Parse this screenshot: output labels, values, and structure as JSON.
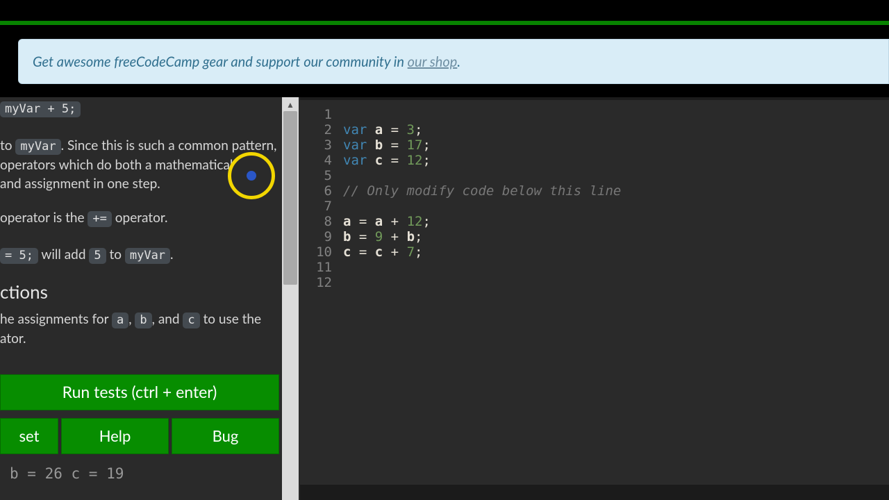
{
  "banner": {
    "prefix": "Get awesome freeCodeCamp gear and support our community in ",
    "link": "our shop",
    "suffix": "."
  },
  "left": {
    "frag_top_code": "myVar + 5;",
    "p1_pre": " to ",
    "p1_code1": "myVar",
    "p1_post1": ". Since this is such a common pattern, operators which do both a mathematical",
    "p1_line3": " and assignment in one step.",
    "p2_pre": " operator is the ",
    "p2_code": "+=",
    "p2_post": " operator.",
    "p3_code1": "= 5;",
    "p3_mid": " will add ",
    "p3_code2": "5",
    "p3_mid2": " to ",
    "p3_code3": "myVar",
    "p3_end": ".",
    "heading": "ctions",
    "p4_pre": "he assignments for ",
    "p4_c1": "a",
    "p4_s1": ", ",
    "p4_c2": "b",
    "p4_s2": ", and ",
    "p4_c3": "c",
    "p4_post": " to use the ",
    "p4_line2": "ator.",
    "run": "Run tests (ctrl + enter)",
    "reset": "set",
    "help": "Help",
    "bug": "Bug",
    "testout": "b = 26   c = 19"
  },
  "editor": {
    "lines": [
      {
        "n": "1",
        "tokens": []
      },
      {
        "n": "2",
        "tokens": [
          [
            "kw",
            "var "
          ],
          [
            "vn",
            "a"
          ],
          [
            "op",
            " = "
          ],
          [
            "num",
            "3"
          ],
          [
            "pn",
            ";"
          ]
        ]
      },
      {
        "n": "3",
        "tokens": [
          [
            "kw",
            "var "
          ],
          [
            "vn",
            "b"
          ],
          [
            "op",
            " = "
          ],
          [
            "num",
            "17"
          ],
          [
            "pn",
            ";"
          ]
        ]
      },
      {
        "n": "4",
        "tokens": [
          [
            "kw",
            "var "
          ],
          [
            "vn",
            "c"
          ],
          [
            "op",
            " = "
          ],
          [
            "num",
            "12"
          ],
          [
            "pn",
            ";"
          ]
        ]
      },
      {
        "n": "5",
        "tokens": []
      },
      {
        "n": "6",
        "tokens": [
          [
            "cm",
            "// Only modify code below this line"
          ]
        ]
      },
      {
        "n": "7",
        "tokens": []
      },
      {
        "n": "8",
        "tokens": [
          [
            "vn",
            "a"
          ],
          [
            "op",
            " = "
          ],
          [
            "vn",
            "a"
          ],
          [
            "op",
            " + "
          ],
          [
            "num",
            "12"
          ],
          [
            "pn",
            ";"
          ]
        ]
      },
      {
        "n": "9",
        "tokens": [
          [
            "vn",
            "b"
          ],
          [
            "op",
            " = "
          ],
          [
            "num",
            "9"
          ],
          [
            "op",
            " + "
          ],
          [
            "vn",
            "b"
          ],
          [
            "pn",
            ";"
          ]
        ]
      },
      {
        "n": "10",
        "tokens": [
          [
            "vn",
            "c"
          ],
          [
            "op",
            " = "
          ],
          [
            "vn",
            "c"
          ],
          [
            "op",
            " + "
          ],
          [
            "num",
            "7"
          ],
          [
            "pn",
            ";"
          ]
        ]
      },
      {
        "n": "11",
        "tokens": []
      },
      {
        "n": "12",
        "tokens": []
      }
    ]
  },
  "icons": {
    "scroll_up": "▲"
  }
}
